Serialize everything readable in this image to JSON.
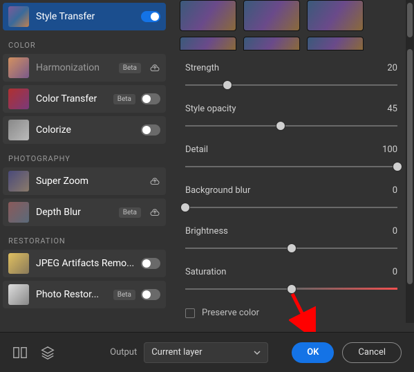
{
  "sidebar": {
    "sections": [
      {
        "header": null,
        "items": [
          {
            "label": "Style Transfer",
            "selected": true,
            "beta": false,
            "switch": true,
            "switch_on": true,
            "cloud": false
          }
        ]
      },
      {
        "header": "COLOR",
        "items": [
          {
            "label": "Harmonization",
            "beta": true,
            "switch": false,
            "cloud": true,
            "dim": true
          },
          {
            "label": "Color Transfer",
            "beta": true,
            "switch": true,
            "switch_on": false,
            "cloud": false
          },
          {
            "label": "Colorize",
            "beta": false,
            "switch": true,
            "switch_on": false,
            "cloud": false
          }
        ]
      },
      {
        "header": "PHOTOGRAPHY",
        "items": [
          {
            "label": "Super Zoom",
            "beta": false,
            "switch": false,
            "cloud": true
          },
          {
            "label": "Depth Blur",
            "beta": true,
            "switch": false,
            "cloud": true
          }
        ]
      },
      {
        "header": "RESTORATION",
        "items": [
          {
            "label": "JPEG Artifacts Remo...",
            "beta": false,
            "switch": true,
            "switch_on": false,
            "cloud": false
          },
          {
            "label": "Photo Restor...",
            "beta": true,
            "switch": true,
            "switch_on": false,
            "cloud": false
          }
        ]
      }
    ]
  },
  "panel": {
    "sliders": [
      {
        "name": "Strength",
        "value": 20,
        "pos": 20
      },
      {
        "name": "Style opacity",
        "value": 45,
        "pos": 45
      },
      {
        "name": "Detail",
        "value": 100,
        "pos": 100
      },
      {
        "name": "Background blur",
        "value": 0,
        "pos": 0
      },
      {
        "name": "Brightness",
        "value": 0,
        "pos": 50
      },
      {
        "name": "Saturation",
        "value": 0,
        "pos": 50,
        "sat": true
      }
    ],
    "preserve_color": "Preserve color"
  },
  "footer": {
    "output_label": "Output",
    "output_value": "Current layer",
    "ok": "OK",
    "cancel": "Cancel"
  }
}
